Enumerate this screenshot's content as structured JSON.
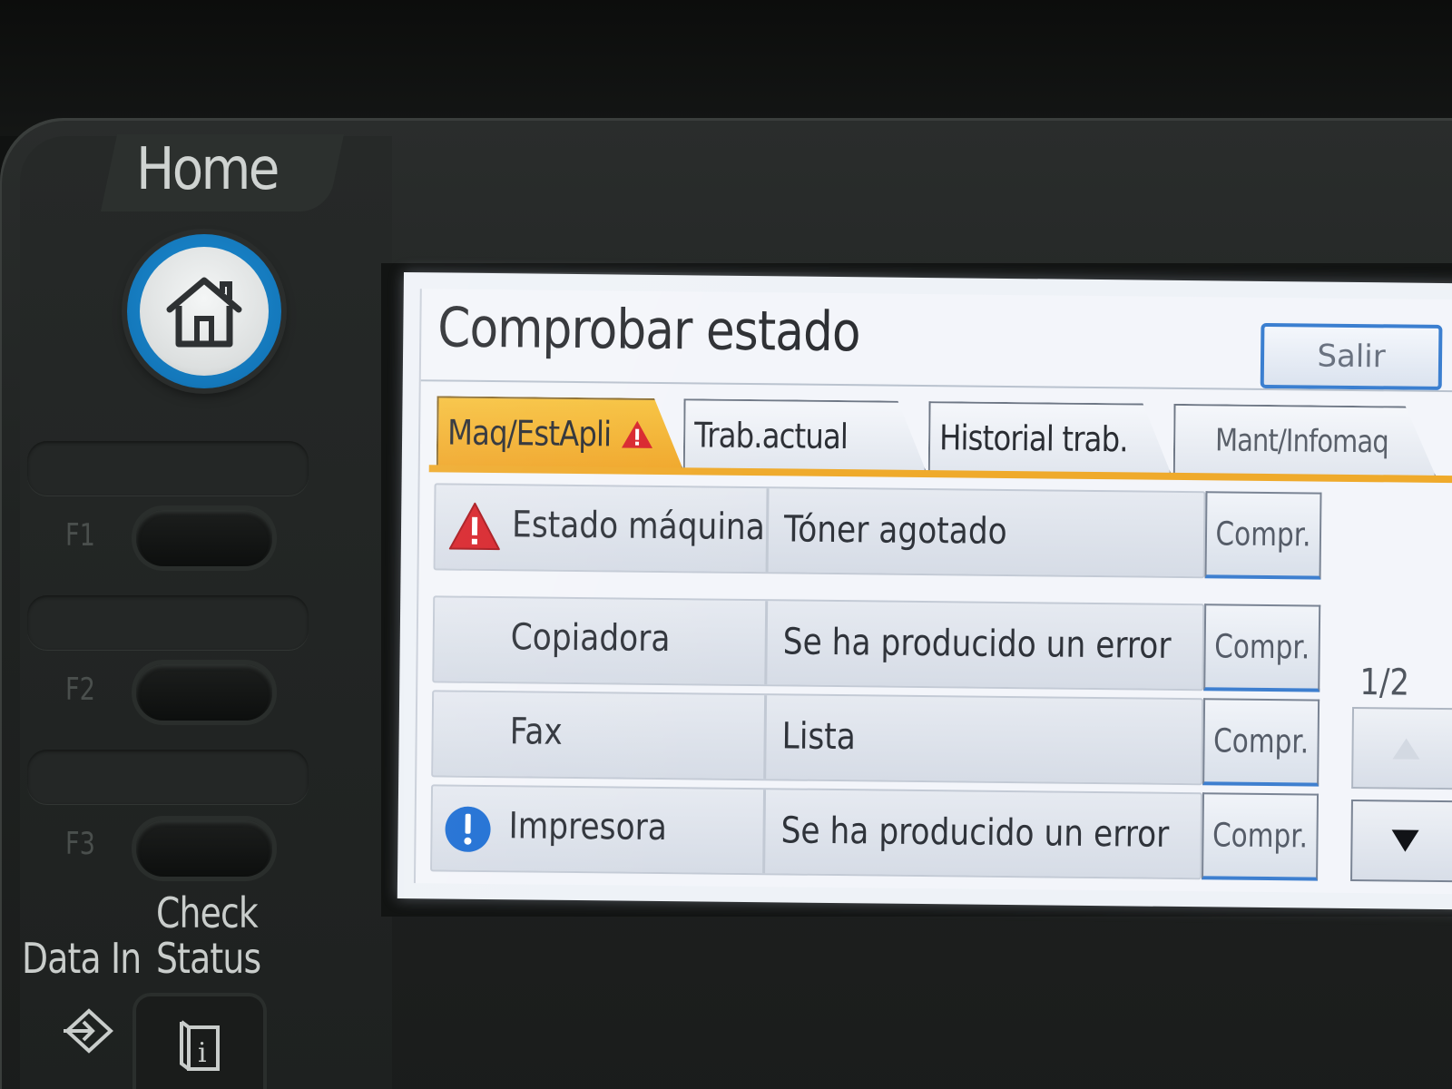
{
  "panel": {
    "home_label": "Home",
    "function_keys": [
      {
        "label": "F1"
      },
      {
        "label": "F2"
      },
      {
        "label": "F3"
      }
    ],
    "data_in_label": "Data In",
    "check_status_line1": "Check",
    "check_status_line2": "Status"
  },
  "screen": {
    "title": "Comprobar estado",
    "exit_label": "Salir",
    "tabs": [
      {
        "label": "Maq/EstApli",
        "active": true,
        "warning": true
      },
      {
        "label": "Trab.actual",
        "active": false
      },
      {
        "label": "Historial trab.",
        "active": false
      },
      {
        "label": "Mant/Infomaq",
        "active": false
      }
    ],
    "rows": [
      {
        "label": "Estado máquina",
        "value": "Tóner agotado",
        "icon": "warning-icon",
        "button": "Compr."
      },
      {
        "label": "Copiadora",
        "value": "Se ha producido un error",
        "icon": "",
        "button": "Compr."
      },
      {
        "label": "Fax",
        "value": "Lista",
        "icon": "",
        "button": "Compr."
      },
      {
        "label": "Impresora",
        "value": "Se ha producido un error",
        "icon": "info-icon",
        "button": "Compr."
      }
    ],
    "page_indicator": "1/2"
  },
  "colors": {
    "accent_tab": "#f0a628",
    "warning": "#d8232a",
    "info": "#1f6fd4",
    "button_border": "#3e7fcf"
  }
}
